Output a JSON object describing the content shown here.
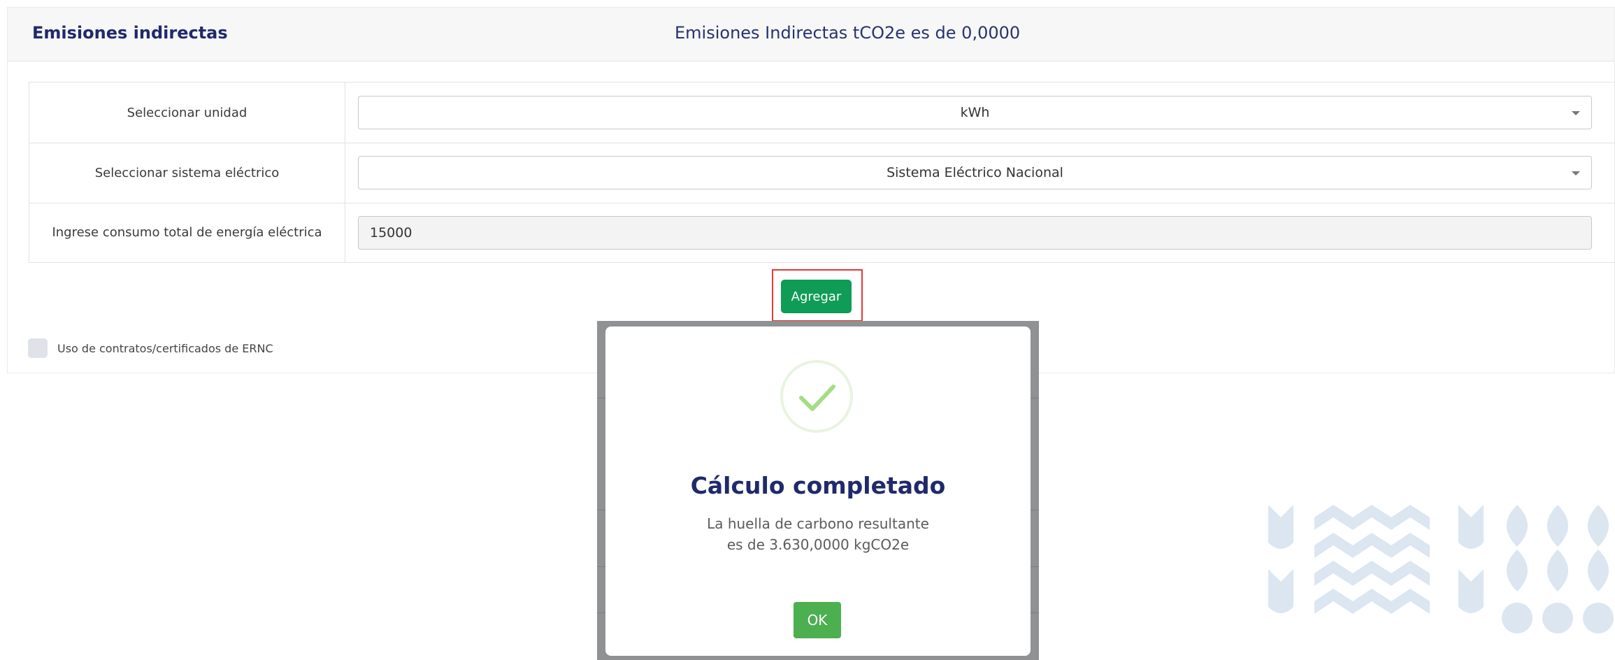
{
  "card": {
    "title": "Emisiones indirectas",
    "summary": "Emisiones Indirectas tCO2e es de 0,0000"
  },
  "form": {
    "unit_label": "Seleccionar unidad",
    "unit_value": "kWh",
    "system_label": "Seleccionar sistema eléctrico",
    "system_value": "Sistema Eléctrico Nacional",
    "consumption_label": "Ingrese consumo total de energía eléctrica",
    "consumption_value": "15000",
    "add_button": "Agregar"
  },
  "checkbox": {
    "label": "Uso de contratos/certificados de ERNC",
    "checked": false
  },
  "modal": {
    "title": "Cálculo completado",
    "line1": "La huella de carbono resultante",
    "line2": "es de 3.630,0000 kgCO2e",
    "ok_button": "OK",
    "icon": "checkmark-icon"
  },
  "colors": {
    "brand": "#1f2a6b",
    "primary_button": "#0e9c56",
    "ok_button": "#4caf50",
    "highlight_border": "#e53935",
    "logo": "#dbe6f1"
  }
}
